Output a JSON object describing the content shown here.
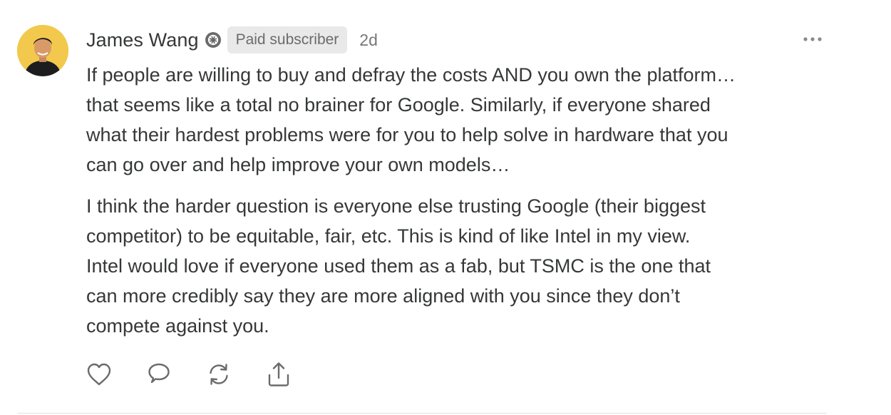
{
  "comment": {
    "author_name": "James Wang",
    "badge_icon": "substack-gear-icon",
    "subscriber_badge": "Paid subscriber",
    "timestamp": "2d",
    "more_icon": "more-horizontal-icon",
    "paragraphs": [
      "If people are willing to buy and defray the costs AND you own the platform…\nthat seems like a total no brainer for Google. Similarly, if everyone shared\nwhat their hardest problems were for you to help solve in hardware that you\ncan go over and help improve your own models…",
      "I think the harder question is everyone else trusting Google (their biggest\ncompetitor) to be equitable, fair, etc. This is kind of like Intel in my view.\nIntel would love if everyone used them as a fab, but TSMC is the one that\ncan more credibly say they are more aligned with you since they don’t\ncompete against you."
    ],
    "actions": [
      "like-icon",
      "reply-icon",
      "restack-icon",
      "share-icon"
    ]
  },
  "colors": {
    "text": "#363737",
    "muted": "#777777",
    "badge_bg": "#e9e9e9",
    "avatar_bg": "#f2c94c"
  }
}
